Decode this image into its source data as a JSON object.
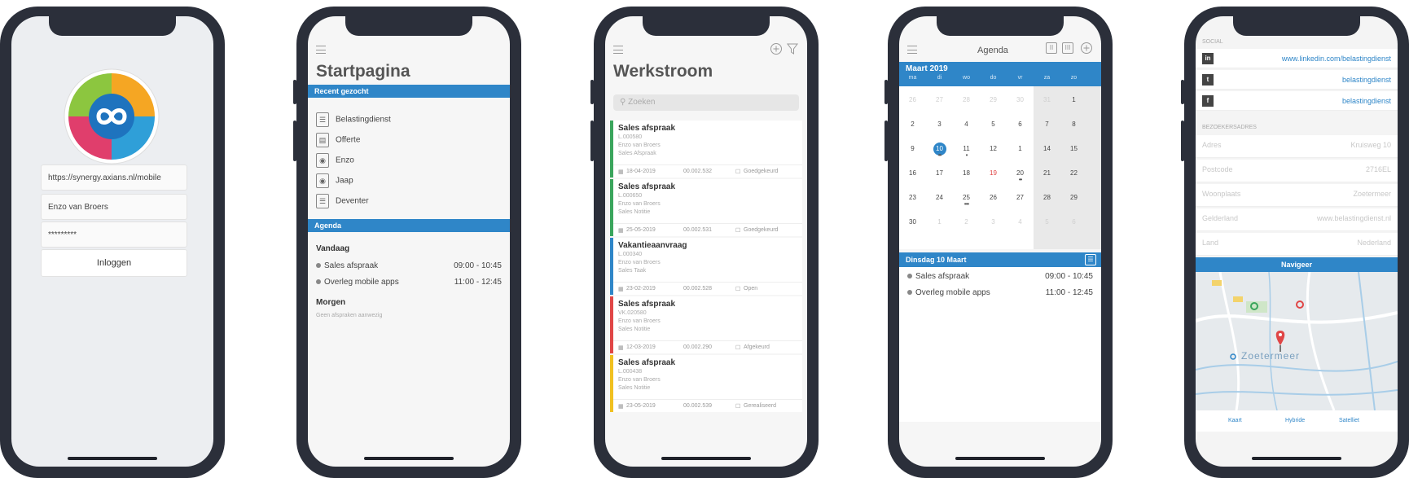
{
  "login": {
    "server_url": "https://synergy.axians.nl/mobile",
    "username": "Enzo van Broers",
    "password": "*********",
    "login_label": "Inloggen"
  },
  "start": {
    "title": "Startpagina",
    "recent_header": "Recent gezocht",
    "recent": [
      {
        "icon": "building-icon",
        "label": "Belastingdienst"
      },
      {
        "icon": "document-icon",
        "label": "Offerte"
      },
      {
        "icon": "person-icon",
        "label": "Enzo"
      },
      {
        "icon": "person-icon",
        "label": "Jaap"
      },
      {
        "icon": "building-icon",
        "label": "Deventer"
      }
    ],
    "agenda_header": "Agenda",
    "today_label": "Vandaag",
    "today_items": [
      {
        "label": "Sales afspraak",
        "time": "09:00 - 10:45"
      },
      {
        "label": "Overleg mobile apps",
        "time": "11:00 - 12:45"
      }
    ],
    "tomorrow_label": "Morgen",
    "tomorrow_empty": "Geen afspraken aanwezig"
  },
  "workflow": {
    "title": "Werkstroom",
    "search_placeholder": "Zoeken",
    "cards": [
      {
        "title": "Sales afspraak",
        "code": "L.000580",
        "person": "Enzo van Broers",
        "type": "Sales Afspraak",
        "date": "18-04-2019",
        "number": "00.002.532",
        "status": "Goedgekeurd",
        "color": "#3aa55c"
      },
      {
        "title": "Sales afspraak",
        "code": "L.000650",
        "person": "Enzo van Broers",
        "type": "Sales Notitie",
        "date": "25-05-2019",
        "number": "00.002.531",
        "status": "Goedgekeurd",
        "color": "#3aa55c"
      },
      {
        "title": "Vakantieaanvraag",
        "code": "L.000340",
        "person": "Enzo van Broers",
        "type": "Sales Taak",
        "date": "23-02-2019",
        "number": "00.002.528",
        "status": "Open",
        "color": "#2f86c8"
      },
      {
        "title": "Sales afspraak",
        "code": "VK.020580",
        "person": "Enzo van Broers",
        "type": "Sales Notitie",
        "date": "12-03-2019",
        "number": "00.002.290",
        "status": "Afgekeurd",
        "color": "#e04646"
      },
      {
        "title": "Sales afspraak",
        "code": "L.000438",
        "person": "Enzo van Broers",
        "type": "Sales Notitie",
        "date": "23-05-2019",
        "number": "00.002.539",
        "status": "Gerealiseerd",
        "color": "#f0c020"
      }
    ]
  },
  "calendar": {
    "title": "Agenda",
    "month": "Maart 2019",
    "weekdays": [
      "ma",
      "di",
      "wo",
      "do",
      "vr",
      "za",
      "zo"
    ],
    "weeks": [
      [
        "26",
        "27",
        "28",
        "29",
        "30",
        "31",
        "1"
      ],
      [
        "2",
        "3",
        "4",
        "5",
        "6",
        "7",
        "8"
      ],
      [
        "9",
        "10",
        "11",
        "12",
        "1",
        "14",
        "15"
      ],
      [
        "16",
        "17",
        "18",
        "19",
        "20",
        "21",
        "22"
      ],
      [
        "23",
        "24",
        "25",
        "26",
        "27",
        "28",
        "29"
      ],
      [
        "30",
        "1",
        "2",
        "3",
        "4",
        "5",
        "6"
      ]
    ],
    "day_header": "Dinsdag 10 Maart",
    "day_items": [
      {
        "label": "Sales afspraak",
        "time": "09:00 - 10:45"
      },
      {
        "label": "Overleg mobile apps",
        "time": "11:00 - 12:45"
      }
    ]
  },
  "contact": {
    "social_header": "SOCIAL",
    "social": [
      {
        "icon": "linkedin-icon",
        "glyph": "in",
        "value": "www.linkedin.com/belastingdienst"
      },
      {
        "icon": "twitter-icon",
        "glyph": "t",
        "value": "belastingdienst"
      },
      {
        "icon": "facebook-icon",
        "glyph": "f",
        "value": "belastingdienst"
      }
    ],
    "address_header": "BEZOEKERSADRES",
    "address": [
      {
        "label": "Adres",
        "value": "Kruisweg 10"
      },
      {
        "label": "Postcode",
        "value": "2716EL"
      },
      {
        "label": "Woonplaats",
        "value": "Zoetermeer"
      },
      {
        "label": "Gelderland",
        "value": "www.belastingdienst.nl"
      },
      {
        "label": "Land",
        "value": "Nederland"
      }
    ],
    "navigate_label": "Navigeer",
    "map_city": "Zoetermeer",
    "map_tabs": [
      "Kaart",
      "Hybride",
      "Satelliet"
    ]
  },
  "colors": {
    "accent": "#2f86c8",
    "phone_frame": "#2b2f3a"
  }
}
